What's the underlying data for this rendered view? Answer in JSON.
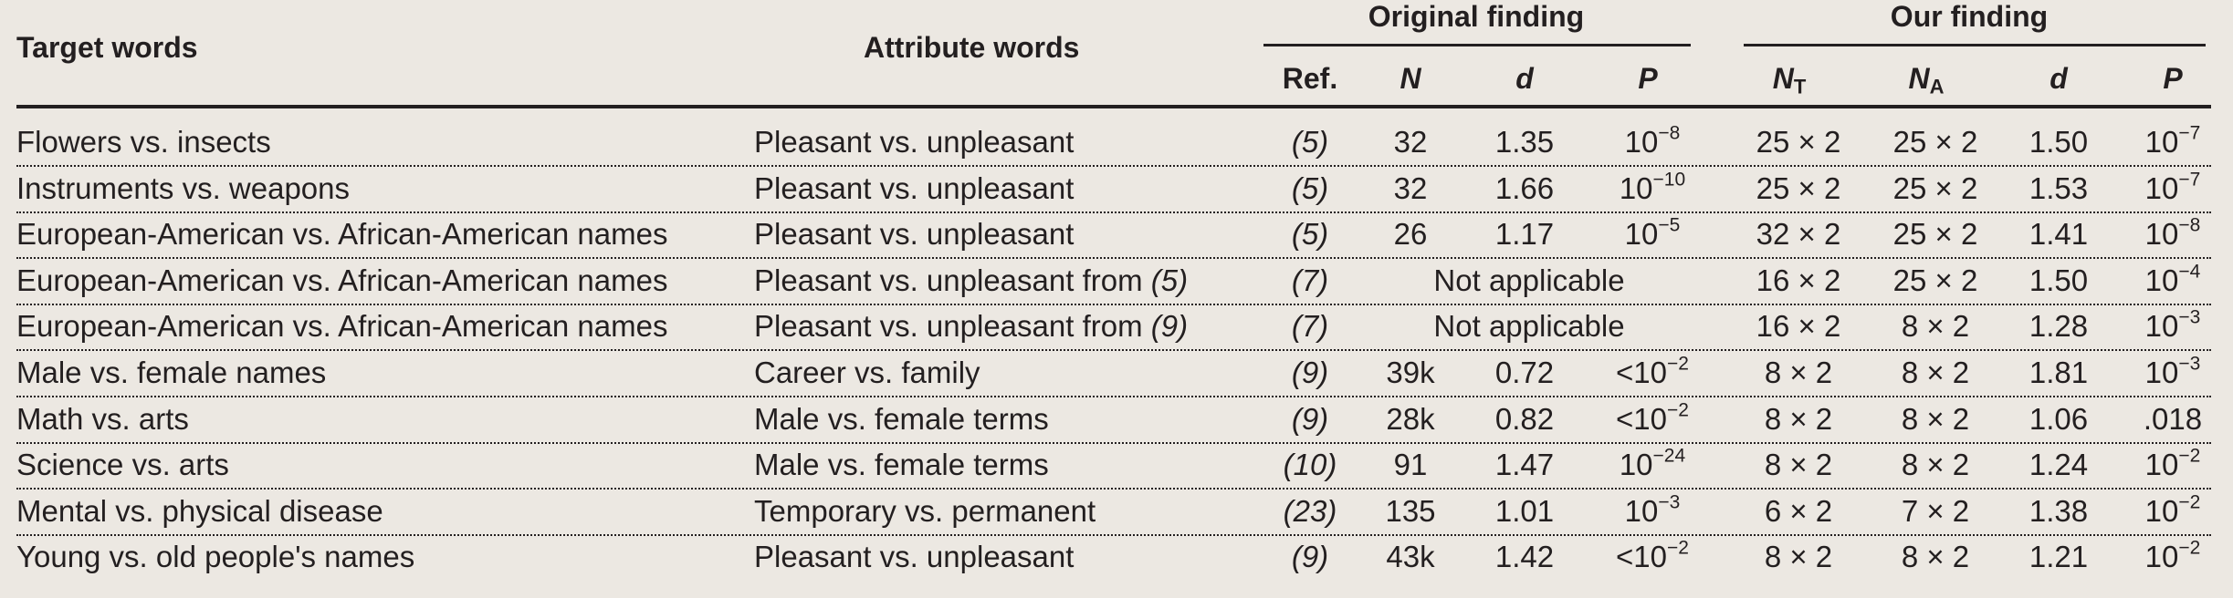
{
  "header": {
    "target_words": "Target words",
    "attribute_words": "Attribute words",
    "original_finding": "Original finding",
    "our_finding": "Our finding",
    "original_cols": {
      "ref": "Ref.",
      "n": "N",
      "d": "d",
      "p": "P"
    },
    "our_cols": {
      "nt": "N",
      "nt_sub": "T",
      "na": "N",
      "na_sub": "A",
      "d": "d",
      "p": "P"
    }
  },
  "rows": [
    {
      "target": "Flowers vs. insects",
      "attribute": "Pleasant vs. unpleasant",
      "attribute_ref": "",
      "ref": "(5)",
      "n": "32",
      "d": "1.35",
      "p_pre": "10",
      "p_exp": "−8",
      "nt": "25 × 2",
      "na": "25 × 2",
      "our_d": "1.50",
      "our_p": "10",
      "our_p_exp": "−7"
    },
    {
      "target": "Instruments vs. weapons",
      "attribute": "Pleasant vs. unpleasant",
      "attribute_ref": "",
      "ref": "(5)",
      "n": "32",
      "d": "1.66",
      "p_pre": "10",
      "p_exp": "−10",
      "nt": "25 × 2",
      "na": "25 × 2",
      "our_d": "1.53",
      "our_p": "10",
      "our_p_exp": "−7"
    },
    {
      "target": "European-American vs. African-American names",
      "attribute": "Pleasant vs. unpleasant",
      "attribute_ref": "",
      "ref": "(5)",
      "n": "26",
      "d": "1.17",
      "p_pre": "10",
      "p_exp": "−5",
      "nt": "32 × 2",
      "na": "25 × 2",
      "our_d": "1.41",
      "our_p": "10",
      "our_p_exp": "−8"
    },
    {
      "target": "European-American vs. African-American names",
      "attribute": "Pleasant vs. unpleasant from",
      "attribute_ref": "(5)",
      "ref": "(7)",
      "na_text": "Not applicable",
      "nt": "16 × 2",
      "na": "25 × 2",
      "our_d": "1.50",
      "our_p": "10",
      "our_p_exp": "−4"
    },
    {
      "target": "European-American vs. African-American names",
      "attribute": "Pleasant vs. unpleasant from",
      "attribute_ref": "(9)",
      "ref": "(7)",
      "na_text": "Not applicable",
      "nt": "16 × 2",
      "na": "8 × 2",
      "our_d": "1.28",
      "our_p": "10",
      "our_p_exp": "−3"
    },
    {
      "target": "Male vs. female names",
      "attribute": "Career vs. family",
      "attribute_ref": "",
      "ref": "(9)",
      "n": "39k",
      "d": "0.72",
      "p_pre": "<10",
      "p_exp": "−2",
      "nt": "8 × 2",
      "na": "8 × 2",
      "our_d": "1.81",
      "our_p": "10",
      "our_p_exp": "−3"
    },
    {
      "target": "Math vs. arts",
      "attribute": "Male vs. female terms",
      "attribute_ref": "",
      "ref": "(9)",
      "n": "28k",
      "d": "0.82",
      "p_pre": "<10",
      "p_exp": "−2",
      "nt": "8 × 2",
      "na": "8 × 2",
      "our_d": "1.06",
      "our_p": ".018",
      "our_p_exp": ""
    },
    {
      "target": "Science vs. arts",
      "attribute": "Male vs. female terms",
      "attribute_ref": "",
      "ref": "(10)",
      "n": "91",
      "d": "1.47",
      "p_pre": "10",
      "p_exp": "−24",
      "nt": "8 × 2",
      "na": "8 × 2",
      "our_d": "1.24",
      "our_p": "10",
      "our_p_exp": "−2"
    },
    {
      "target": "Mental vs. physical disease",
      "attribute": "Temporary vs. permanent",
      "attribute_ref": "",
      "ref": "(23)",
      "n": "135",
      "d": "1.01",
      "p_pre": "10",
      "p_exp": "−3",
      "nt": "6 × 2",
      "na": "7 × 2",
      "our_d": "1.38",
      "our_p": "10",
      "our_p_exp": "−2"
    },
    {
      "target": "Young vs. old people's names",
      "attribute": "Pleasant vs. unpleasant",
      "attribute_ref": "",
      "ref": "(9)",
      "n": "43k",
      "d": "1.42",
      "p_pre": "<10",
      "p_exp": "−2",
      "nt": "8 × 2",
      "na": "8 × 2",
      "our_d": "1.21",
      "our_p": "10",
      "our_p_exp": "−2"
    }
  ]
}
